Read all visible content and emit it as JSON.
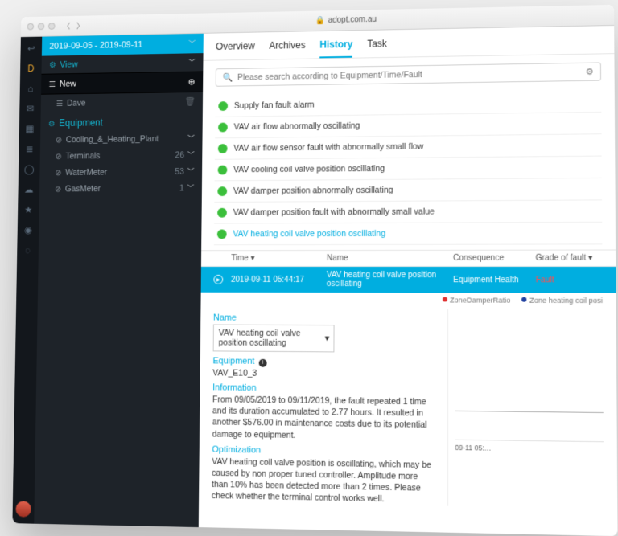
{
  "browser": {
    "address": "adopt.com.au"
  },
  "rail": {
    "items": [
      "back",
      "d",
      "home",
      "inbox",
      "grid",
      "list",
      "cycle",
      "cloud",
      "leaf",
      "globe",
      "help"
    ]
  },
  "sidebar": {
    "date_range": "2019-09-05 - 2019-09-11",
    "view_label": "View",
    "new_label": "New",
    "user_item": "Dave",
    "equipment_label": "Equipment",
    "equipment": [
      {
        "name": "Cooling_&_Heating_Plant",
        "count": ""
      },
      {
        "name": "Terminals",
        "count": "26"
      },
      {
        "name": "WaterMeter",
        "count": "53"
      },
      {
        "name": "GasMeter",
        "count": "1"
      }
    ]
  },
  "tabs": {
    "items": [
      "Overview",
      "Archives",
      "History",
      "Task"
    ],
    "active": "History"
  },
  "search": {
    "placeholder": "Please search according to Equipment/Time/Fault"
  },
  "faults": [
    "Supply fan fault alarm",
    "VAV air flow abnormally oscillating",
    "VAV air flow sensor fault with abnormally small flow",
    "VAV cooling coil valve position oscillating",
    "VAV damper position abnormally oscillating",
    "VAV damper position fault with abnormally small value",
    "VAV heating coil valve position oscillating"
  ],
  "table": {
    "headers": {
      "time": "Time ▾",
      "name": "Name",
      "consequence": "Consequence",
      "grade": "Grade of fault ▾"
    },
    "row": {
      "time": "2019-09-11 05:44:17",
      "name": "VAV heating coil valve position oscillating",
      "consequence": "Equipment Health",
      "grade": "Fault"
    }
  },
  "legend": {
    "a": "ZoneDamperRatio",
    "b": "Zone heating coil posi"
  },
  "detail": {
    "name_label": "Name",
    "name_value": "VAV heating coil valve position oscillating",
    "equipment_label": "Equipment",
    "equipment_value": "VAV_E10_3",
    "information_label": "Information",
    "information_text": "From 09/05/2019 to 09/11/2019, the fault repeated 1 time and its duration accumulated to 2.77 hours. It resulted in another $576.00 in maintenance costs due to its potential damage to equipment.",
    "optimization_label": "Optimization",
    "optimization_text": "VAV heating coil valve position is oscillating, which may be caused by non proper tuned controller. Amplitude more than 10% has been detected more than 2 times. Please check whether the terminal control works well.",
    "xaxis": "09-11 05:…"
  },
  "colors": {
    "accent": "#00aee0",
    "green": "#3bbf3b",
    "red": "#ff4d4d",
    "legend_a": "#e03030",
    "legend_b": "#2040a0"
  }
}
